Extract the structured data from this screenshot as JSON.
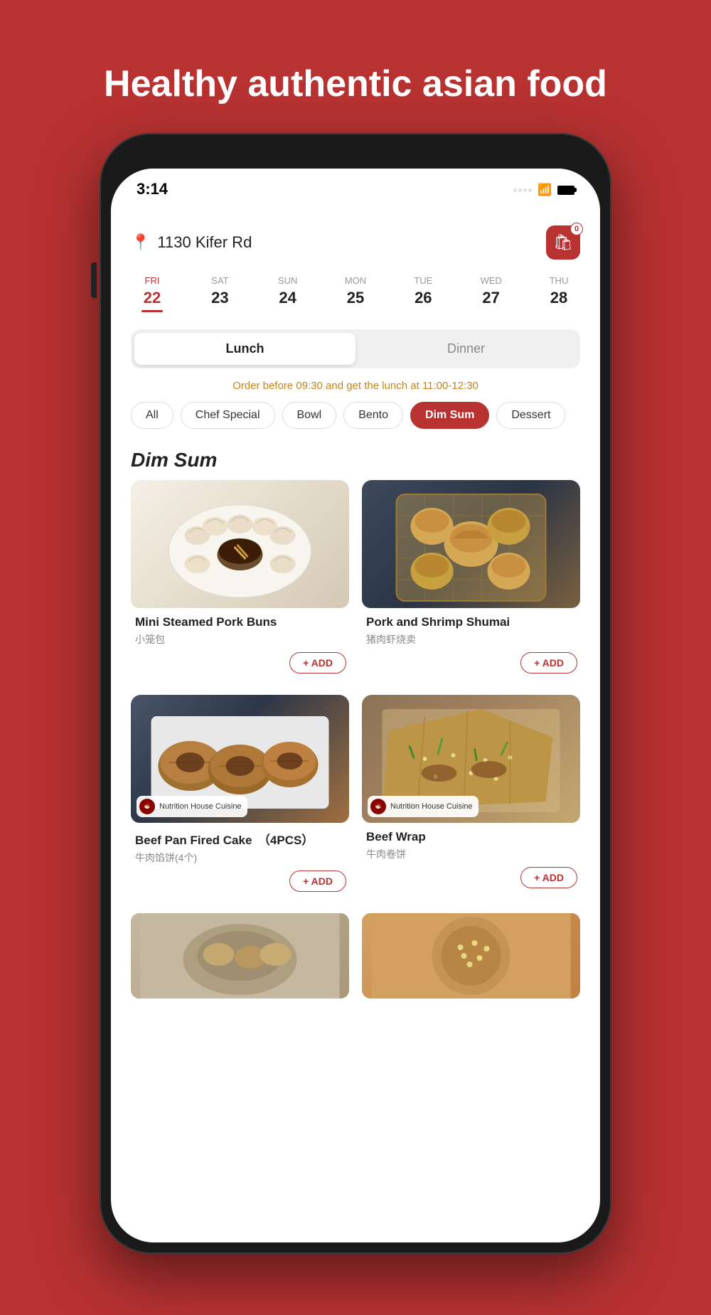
{
  "page": {
    "headline": "Healthy authentic asian food",
    "background_color": "#b83232"
  },
  "status_bar": {
    "time": "3:14"
  },
  "header": {
    "address": "1130 Kifer Rd",
    "cart_count": "0"
  },
  "date_selector": {
    "days": [
      {
        "label": "FRI",
        "number": "22",
        "active": true
      },
      {
        "label": "SAT",
        "number": "23",
        "active": false
      },
      {
        "label": "SUN",
        "number": "24",
        "active": false
      },
      {
        "label": "MON",
        "number": "25",
        "active": false
      },
      {
        "label": "TUE",
        "number": "26",
        "active": false
      },
      {
        "label": "WED",
        "number": "27",
        "active": false
      },
      {
        "label": "THU",
        "number": "28",
        "active": false
      }
    ]
  },
  "meal_toggle": {
    "options": [
      "Lunch",
      "Dinner"
    ],
    "active": "Lunch"
  },
  "order_notice": "Order before 09:30 and get the lunch at 11:00-12:30",
  "categories": {
    "items": [
      "All",
      "Chef Special",
      "Bowl",
      "Bento",
      "Dim Sum",
      "Dessert"
    ],
    "active": "Dim Sum"
  },
  "section": {
    "title": "Dim Sum",
    "foods": [
      {
        "name": "Mini Steamed Pork Buns",
        "name_cn": "小笼包",
        "add_label": "+ ADD",
        "has_badge": false,
        "img_type": "dumplings-white"
      },
      {
        "name": "Pork and Shrimp Shumai",
        "name_cn": "猪肉虾烧卖",
        "add_label": "+ ADD",
        "has_badge": false,
        "img_type": "shumai"
      },
      {
        "name": "Beef Pan Fired Cake　（4PCS）",
        "name_cn": "牛肉馅饼(4个)",
        "add_label": "+ ADD",
        "has_badge": true,
        "restaurant_name": "Nutrition House Cuisine",
        "img_type": "beef-cake"
      },
      {
        "name": "Beef Wrap",
        "name_cn": "牛肉卷饼",
        "add_label": "+ ADD",
        "has_badge": true,
        "restaurant_name": "Nutrition House Cuisine",
        "img_type": "beef-wrap"
      }
    ]
  }
}
